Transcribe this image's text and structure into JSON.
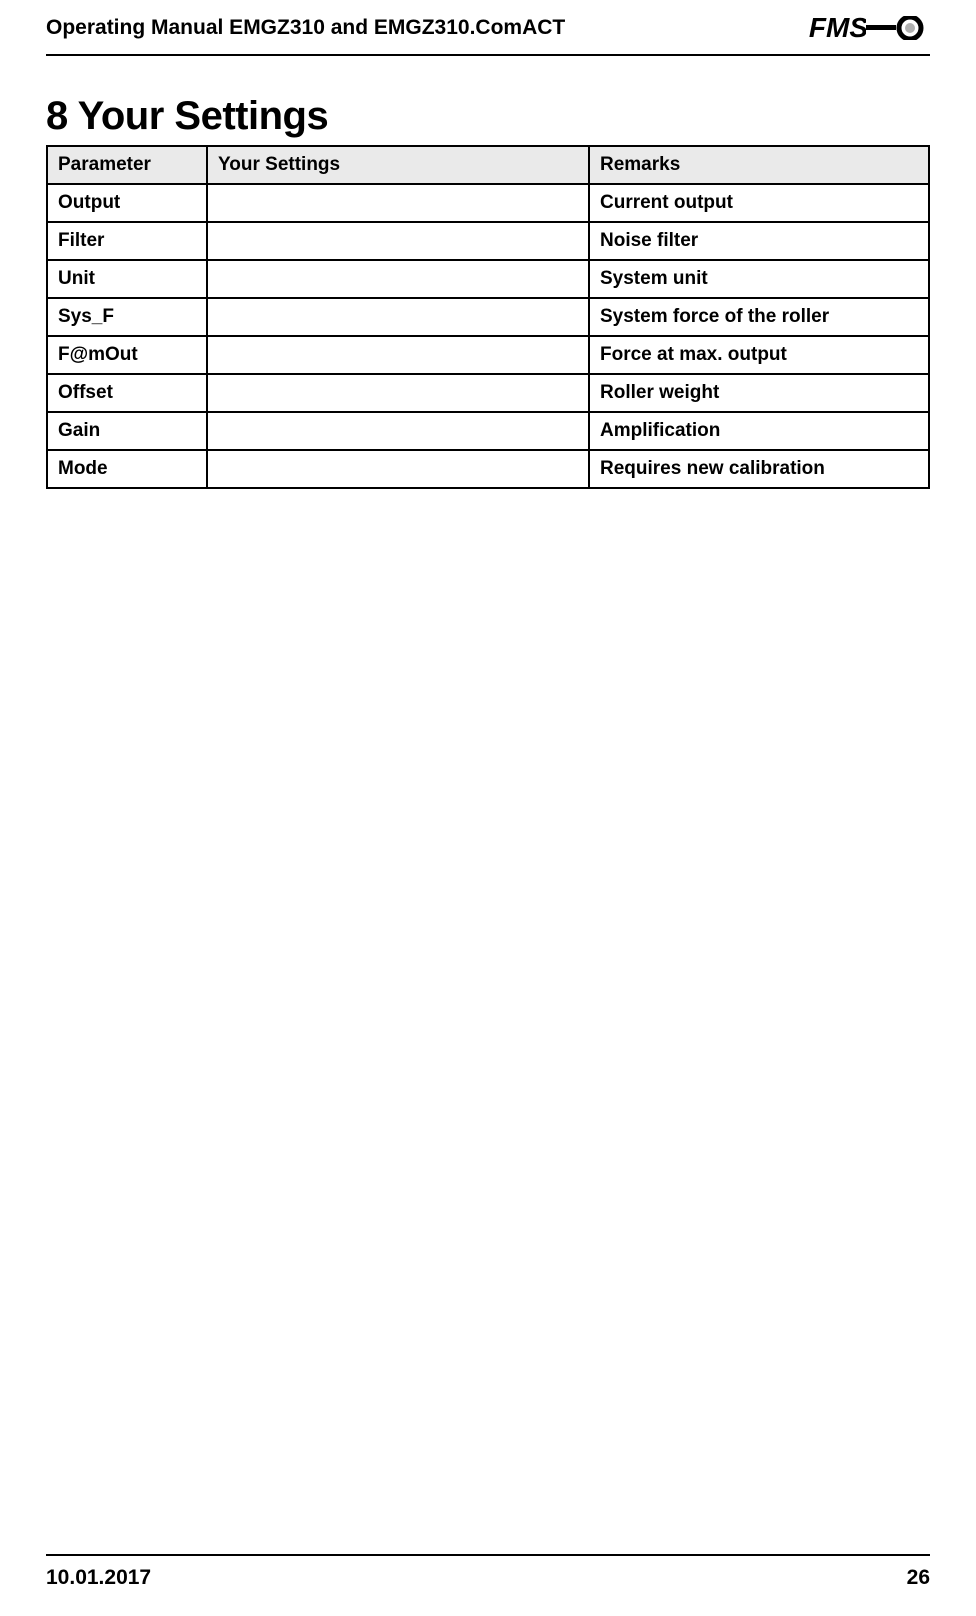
{
  "header": {
    "title": "Operating Manual EMGZ310 and EMGZ310.ComACT",
    "logo_text": "FMS"
  },
  "section": {
    "title": "8 Your Settings"
  },
  "table": {
    "headers": {
      "parameter": "Parameter",
      "your_settings": "Your Settings",
      "remarks": "Remarks"
    },
    "rows": [
      {
        "parameter": "Output",
        "your_settings": "",
        "remarks": "Current output"
      },
      {
        "parameter": "Filter",
        "your_settings": "",
        "remarks": "Noise filter"
      },
      {
        "parameter": "Unit",
        "your_settings": "",
        "remarks": "System unit"
      },
      {
        "parameter": "Sys_F",
        "your_settings": "",
        "remarks": "System force of the roller"
      },
      {
        "parameter": "F@mOut",
        "your_settings": "",
        "remarks": "Force at max. output"
      },
      {
        "parameter": "Offset",
        "your_settings": "",
        "remarks": "Roller weight"
      },
      {
        "parameter": "Gain",
        "your_settings": "",
        "remarks": "Amplification"
      },
      {
        "parameter": "Mode",
        "your_settings": "",
        "remarks": "Requires new calibration"
      }
    ]
  },
  "footer": {
    "date": "10.01.2017",
    "page": "26"
  }
}
